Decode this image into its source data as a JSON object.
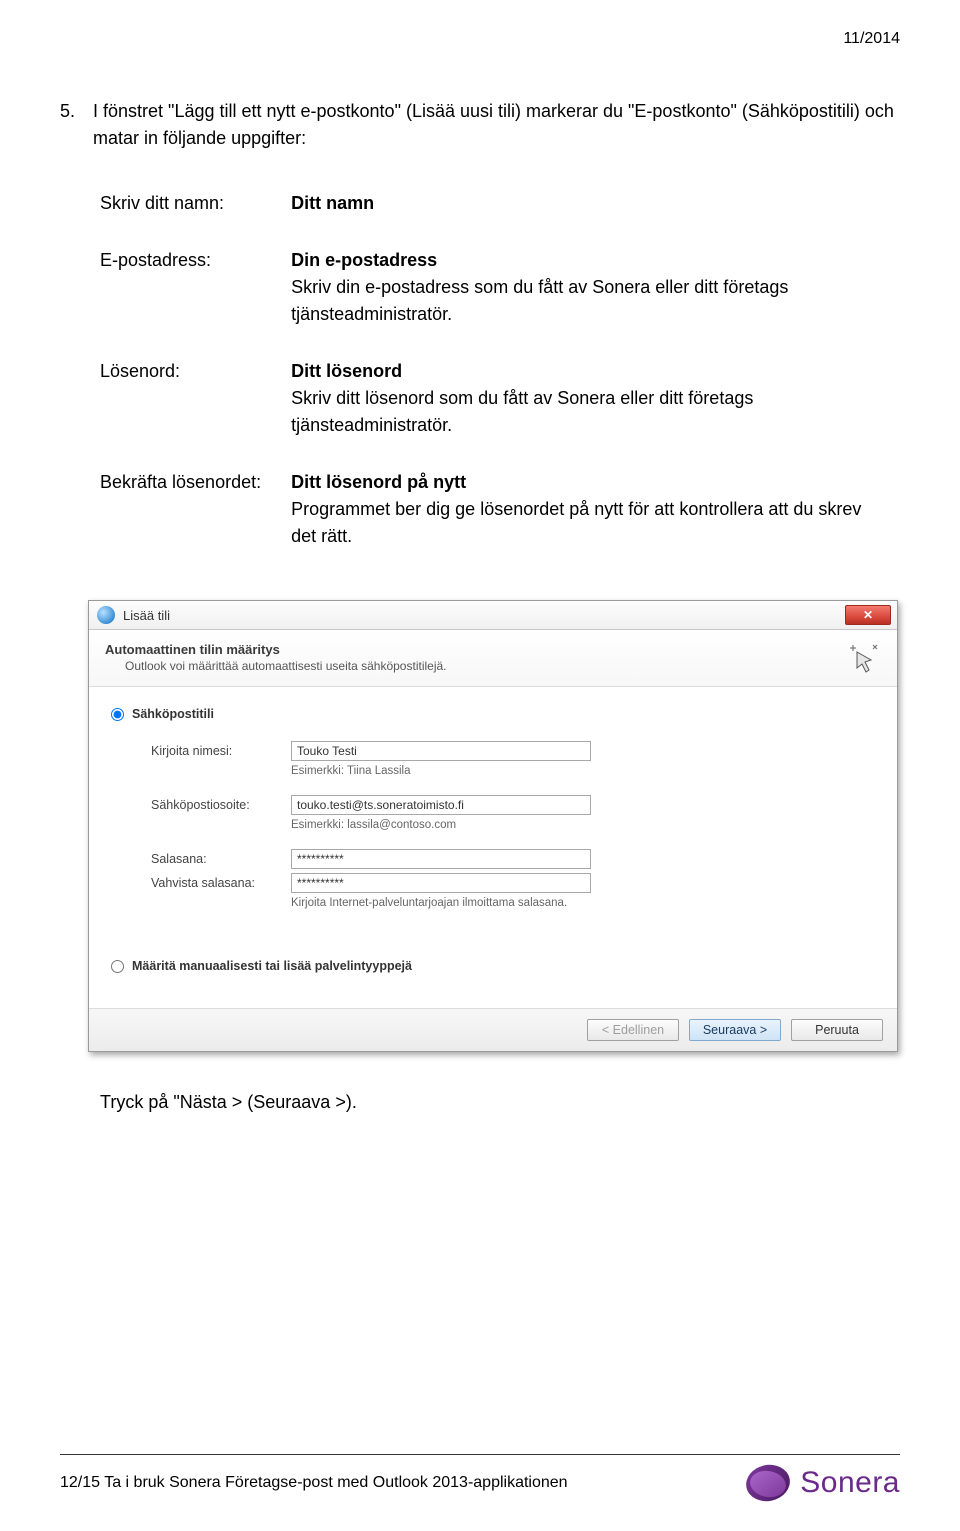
{
  "header_date": "11/2014",
  "step": {
    "number": "5.",
    "text": "I fönstret \"Lägg till ett nytt e-postkonto\" (Lisää uusi tili) markerar du \"E-postkonto\" (Sähköpostitili) och matar in följande uppgifter:"
  },
  "defs": [
    {
      "label": "Skriv ditt namn:",
      "bold": "Ditt namn",
      "desc": ""
    },
    {
      "label": "E-postadress:",
      "bold": "Din e-postadress",
      "desc": "Skriv din e-postadress som du fått av Sonera eller ditt företags tjänsteadministratör."
    },
    {
      "label": "Lösenord:",
      "bold": "Ditt lösenord",
      "desc": "Skriv ditt lösenord som du fått av Sonera eller ditt företags tjänsteadministratör."
    },
    {
      "label": "Bekräfta lösenordet:",
      "bold": "Ditt lösenord på nytt",
      "desc": "Programmet ber dig ge lösenordet på nytt för att kontrollera att du skrev det rätt."
    }
  ],
  "dialog": {
    "title": "Lisää tili",
    "head_title": "Automaattinen tilin määritys",
    "head_sub": "Outlook voi määrittää automaattisesti useita sähköpostitilejä.",
    "radio_email": "Sähköpostitili",
    "radio_manual": "Määritä manuaalisesti tai lisää palvelintyyppejä",
    "fields": {
      "name_label": "Kirjoita nimesi:",
      "name_value": "Touko Testi",
      "name_hint": "Esimerkki: Tiina Lassila",
      "email_label": "Sähköpostiosoite:",
      "email_value": "touko.testi@ts.soneratoimisto.fi",
      "email_hint": "Esimerkki: lassila@contoso.com",
      "pw_label": "Salasana:",
      "pw_value": "**********",
      "pw2_label": "Vahvista salasana:",
      "pw2_value": "**********",
      "pw_hint": "Kirjoita Internet-palveluntarjoajan ilmoittama salasana."
    },
    "buttons": {
      "back": "< Edellinen",
      "next": "Seuraava >",
      "cancel": "Peruuta"
    }
  },
  "after": "Tryck på \"Nästa > (Seuraava >).",
  "footer": {
    "left": "12/15   Ta i bruk Sonera Företagse-post med Outlook 2013-applikationen",
    "brand": "Sonera"
  }
}
